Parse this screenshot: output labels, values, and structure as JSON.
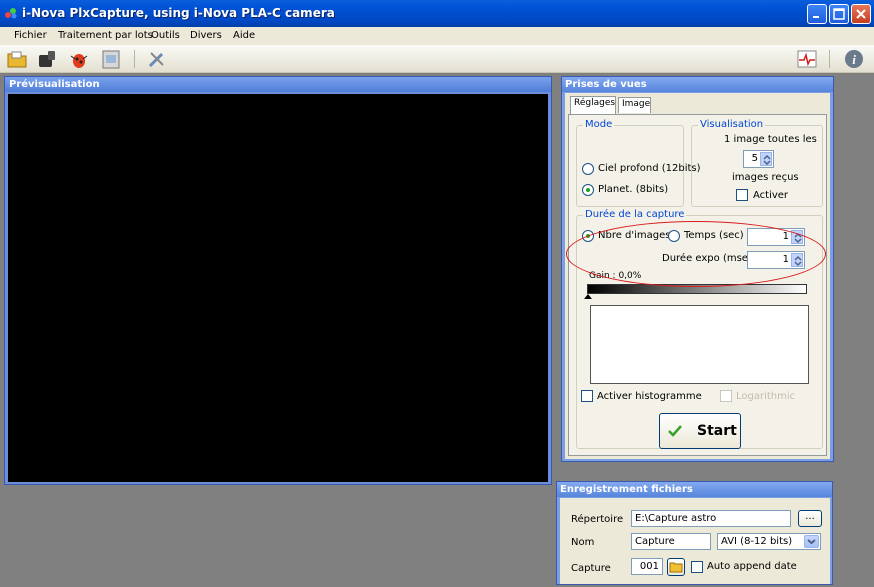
{
  "window": {
    "title": "i-Nova PlxCapture, using i-Nova PLA-C camera",
    "icons": {
      "minimize": "minimize-icon",
      "maximize": "maximize-icon",
      "close": "close-icon"
    }
  },
  "menu": {
    "items": [
      "Fichier",
      "Traitement par lots",
      "Outils",
      "Divers",
      "Aide"
    ]
  },
  "toolbar": {
    "icons": [
      "folder-icon",
      "camera-icon",
      "bug-icon",
      "film-icon",
      "tools-icon",
      "graph-icon",
      "info-icon"
    ]
  },
  "preview": {
    "title": "Prévisualisation"
  },
  "capture_panel": {
    "title": "Prises de vues",
    "tabs": [
      "Réglages",
      "Image"
    ],
    "mode": {
      "legend": "Mode",
      "options": [
        "Ciel profond (12bits)",
        "Planet. (8bits)"
      ],
      "selected": "Planet. (8bits)"
    },
    "visualisation": {
      "legend": "Visualisation",
      "line1": "1 image toutes les",
      "value": "5",
      "line2": "images reçus",
      "activate_label": "Activer"
    },
    "duration": {
      "legend": "Durée de la capture",
      "option_images": "Nbre d'images",
      "option_time": "Temps (sec)",
      "selected": "Nbre d'images",
      "count_value": "1",
      "expo_label": "Durée expo (msec)",
      "expo_value": "1",
      "gain_label": "Gain : 0,0%",
      "gain_level": 0.0
    },
    "histogram_label": "Activer histogramme",
    "log_label": "Logarithmic",
    "start_label": "Start"
  },
  "save_panel": {
    "title": "Enregistrement fichiers",
    "dir_label": "Répertoire",
    "dir_value": "E:\\Capture astro",
    "browse_label": "...",
    "name_label": "Nom",
    "name_value": "Capture",
    "format_value": "AVI (8-12 bits)",
    "capture_label": "Capture",
    "capture_value": "001",
    "auto_append_label": "Auto append date"
  },
  "colors": {
    "title_bar": "#0052d6",
    "panel_header": "#5685dc",
    "annotation": "#d81e1e",
    "legend_text": "#0046d5"
  }
}
